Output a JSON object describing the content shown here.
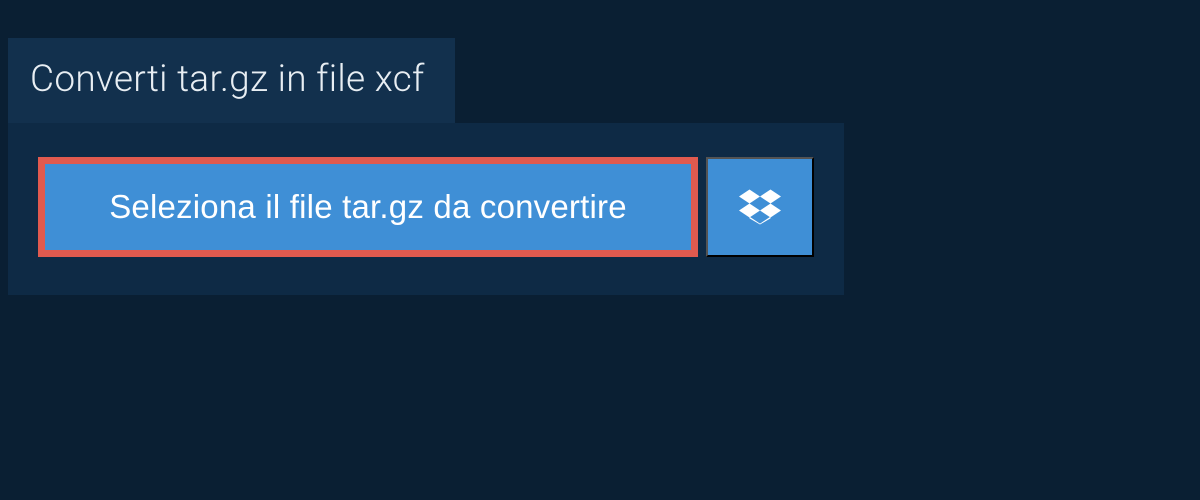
{
  "header": {
    "title": "Converti tar.gz in file xcf"
  },
  "converter": {
    "select_file_label": "Seleziona il file tar.gz da convertire"
  },
  "colors": {
    "background": "#0a1f33",
    "panel": "#0e2a45",
    "header_tab": "#12304d",
    "button_primary": "#3f8fd6",
    "highlight_border": "#e05a4f",
    "text_light": "#ffffff"
  }
}
